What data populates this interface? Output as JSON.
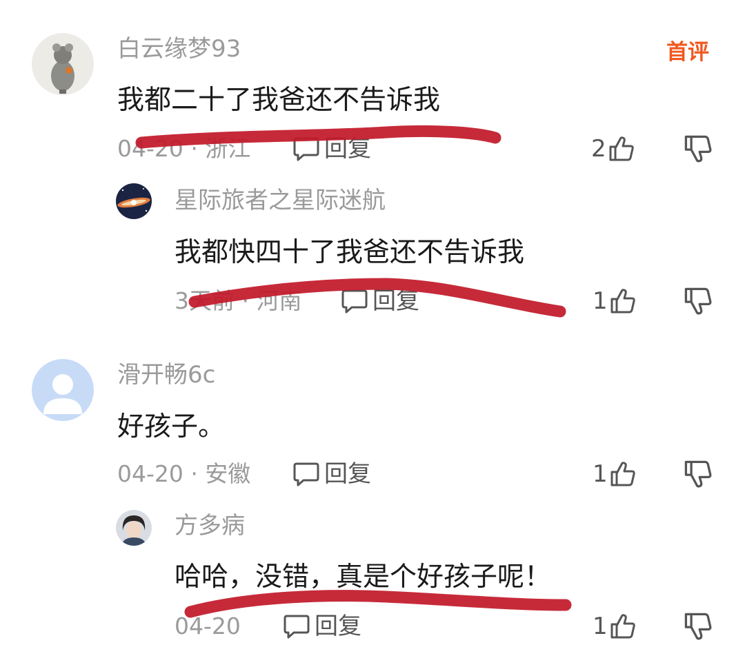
{
  "colors": {
    "badge": "#f0581e",
    "marker": "#c21a2a",
    "secondary_text": "#9a9a9a",
    "primary_text": "#1a1a1a",
    "icon": "#555555"
  },
  "comments": [
    {
      "username": "白云缘梦93",
      "badge": "首评",
      "text": "我都二十了我爸还不告诉我",
      "meta": "04-20 · 浙江",
      "reply_label": "回复",
      "likes": "2",
      "avatar_icon": "mouse-figurine-avatar",
      "replies": [
        {
          "username": "星际旅者之星际迷航",
          "text": "我都快四十了我爸还不告诉我",
          "meta": "3天前 · 河南",
          "reply_label": "回复",
          "likes": "1",
          "avatar_icon": "galaxy-avatar"
        }
      ]
    },
    {
      "username": "滑开畅6c",
      "text": "好孩子。",
      "meta": "04-20 · 安徽",
      "reply_label": "回复",
      "likes": "1",
      "avatar_icon": "default-user-avatar",
      "replies": [
        {
          "username": "方多病",
          "text": "哈哈，没错，真是个好孩子呢！",
          "meta": "04-20",
          "reply_label": "回复",
          "likes": "1",
          "avatar_icon": "portrait-avatar"
        }
      ]
    }
  ]
}
